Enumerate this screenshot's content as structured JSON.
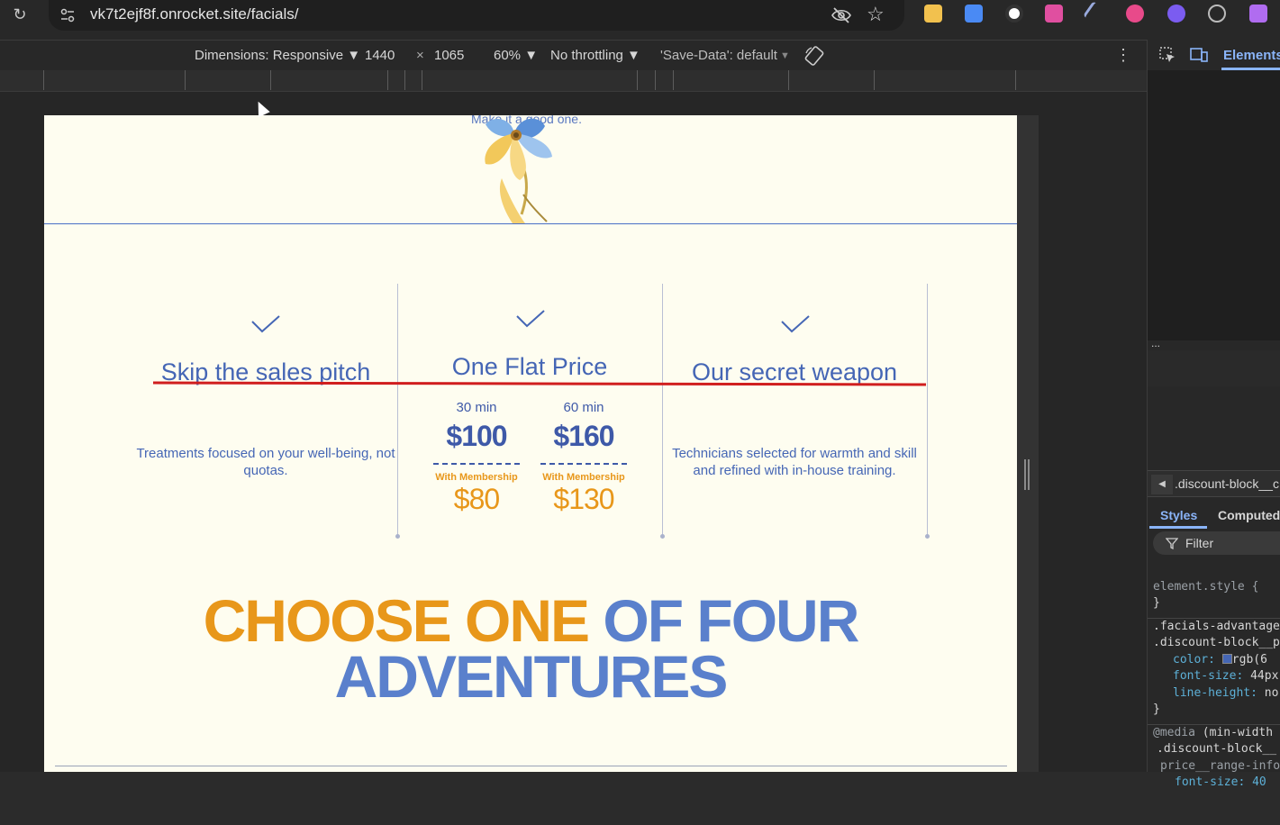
{
  "browser": {
    "url": "vk7t2ejf8f.onrocket.site/facials/",
    "reload_icon": "reload-icon",
    "extensions": [
      "#f2c14e",
      "#4a8af4",
      "#ffffff",
      "#e04fa0",
      "#3a3a3a",
      "#e84a8a",
      "#7b5cf0",
      "#bbbbbb",
      "#b06cf0"
    ]
  },
  "device_toolbar": {
    "dimensions_label": "Dimensions: Responsive ▼",
    "width": "1440",
    "times": "×",
    "height": "1065",
    "zoom": "60% ▼",
    "throttling": "No throttling ▼",
    "save_data": "'Save-Data': default",
    "save_data_arrow": "▼"
  },
  "page": {
    "tagline": "Make it a good one.",
    "columns": [
      {
        "title": "Skip the sales pitch",
        "text": "Treatments focused on your well-being, not quotas."
      },
      {
        "title": "One Flat Price",
        "prices": [
          {
            "duration": "30 min",
            "price": "$100",
            "membership_label": "With Membership",
            "membership_price": "$80"
          },
          {
            "duration": "60 min",
            "price": "$160",
            "membership_label": "With Membership",
            "membership_price": "$130"
          }
        ]
      },
      {
        "title": "Our secret weapon",
        "text": "Technicians selected for warmth and skill and refined with in-house training."
      }
    ],
    "headline_orange": "CHOOSE ONE",
    "headline_blue_1": "OF FOUR",
    "headline_blue_2": "ADVENTURES",
    "colors": {
      "blue": "#4566b5",
      "orange": "#e8971a",
      "bg": "#fefdf0",
      "strike": "#d01e1e"
    }
  },
  "devtools": {
    "elements_tab": "Elements",
    "ellipsis": "...",
    "breadcrumb": ".discount-block__c",
    "styles_tab": "Styles",
    "computed_tab": "Computed",
    "filter_placeholder": "Filter",
    "code": {
      "element_style_open": "element.style {",
      "close": "}",
      "sel1": ".facials-advantage",
      "sel2": ".discount-block__p",
      "color_prop": "color:",
      "color_val": "rgb(6",
      "font_size_prop": "font-size:",
      "font_size_val": "44px",
      "line_height_prop": "line-height:",
      "line_height_val": "no",
      "media_kw": "@media",
      "media_cond": "(min-width",
      "sel3": ".discount-block__",
      "sel4": "price__range-info",
      "font_size_partial": "font-size: 40"
    }
  }
}
